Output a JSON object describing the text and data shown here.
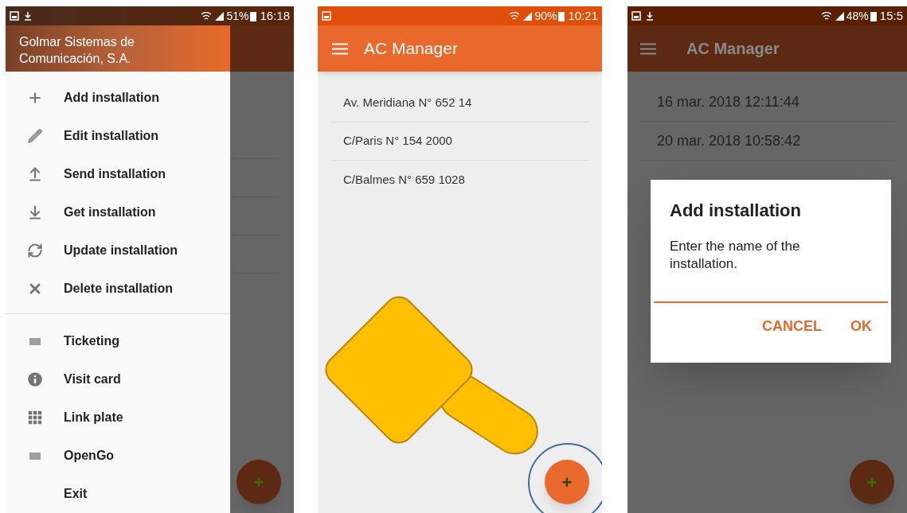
{
  "drawer_screen": {
    "status_bar": {
      "battery": "51%",
      "time": "16:18"
    },
    "drawer": {
      "header": "Golmar Sistemas de Comunicación, S.A.",
      "groups": [
        {
          "items": [
            {
              "label": "Add installation"
            },
            {
              "label": "Edit installation"
            },
            {
              "label": "Send installation"
            },
            {
              "label": "Get installation"
            },
            {
              "label": "Update installation"
            },
            {
              "label": "Delete installation"
            }
          ]
        },
        {
          "items": [
            {
              "label": "Ticketing"
            },
            {
              "label": "Visit card"
            },
            {
              "label": "Link plate"
            },
            {
              "label": "OpenGo"
            },
            {
              "label": "Exit"
            }
          ]
        }
      ]
    },
    "fab": {
      "label": "+"
    }
  },
  "list_screen": {
    "status_bar": {
      "battery": "90%",
      "time": "10:21"
    },
    "app_bar": {
      "title": "AC Manager"
    },
    "rows": [
      {
        "label": "Av. Meridiana N° 652 14"
      },
      {
        "label": "C/Paris N° 154 2000"
      },
      {
        "label": "C/Balmes N° 659 1028"
      }
    ],
    "fab": {
      "label": "+"
    }
  },
  "dialog_screen": {
    "status_bar": {
      "battery": "48%",
      "time": "15:5"
    },
    "app_bar": {
      "title": "AC Manager"
    },
    "rows": [
      {
        "label": "16 mar. 2018 12:11:44"
      },
      {
        "label": "20 mar. 2018 10:58:42"
      }
    ],
    "dialog": {
      "title": "Add installation",
      "message": "Enter the name of the installation.",
      "buttons": [
        "CANCEL",
        "OK"
      ]
    },
    "fab": {
      "label": "+"
    }
  }
}
